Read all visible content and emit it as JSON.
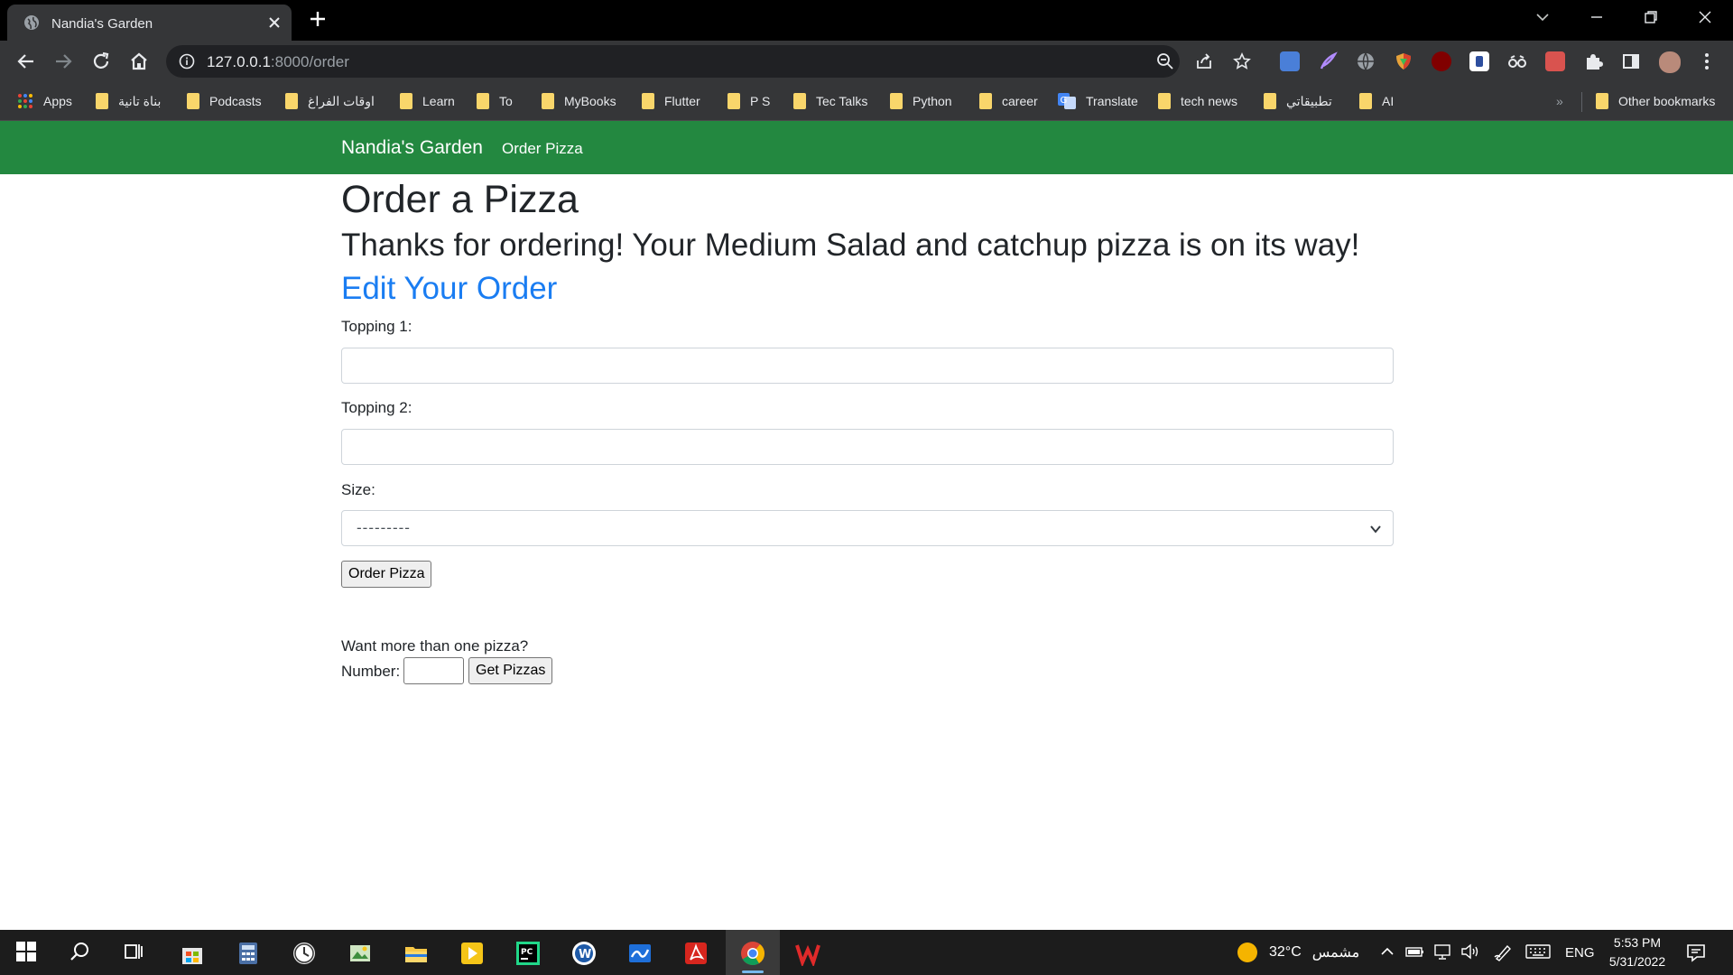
{
  "browser": {
    "tab_title": "Nandia's Garden",
    "url_host": "127.0.0.1",
    "url_rest": ":8000/order",
    "bookmarks": [
      {
        "label": "Apps",
        "type": "apps"
      },
      {
        "label": "بناة تانية",
        "type": "folder"
      },
      {
        "label": "Podcasts",
        "type": "folder"
      },
      {
        "label": "اوقات الفراغ",
        "type": "folder"
      },
      {
        "label": "Learn",
        "type": "folder"
      },
      {
        "label": "To",
        "type": "folder"
      },
      {
        "label": "MyBooks",
        "type": "folder"
      },
      {
        "label": "Flutter",
        "type": "folder"
      },
      {
        "label": "P S",
        "type": "folder"
      },
      {
        "label": "Tec Talks",
        "type": "folder"
      },
      {
        "label": "Python",
        "type": "folder"
      },
      {
        "label": "career",
        "type": "folder"
      },
      {
        "label": "Translate",
        "type": "translate"
      },
      {
        "label": "tech news",
        "type": "folder"
      },
      {
        "label": "تطبيقاتي",
        "type": "folder"
      },
      {
        "label": "AI",
        "type": "folder"
      }
    ],
    "other_bookmarks": "Other bookmarks",
    "overflow": "»"
  },
  "site": {
    "brand": "Nandia's Garden",
    "nav_link": "Order Pizza"
  },
  "page": {
    "heading": "Order a Pizza",
    "confirmation": "Thanks for ordering! Your Medium Salad and catchup pizza is on its way!",
    "edit_link": "Edit Your Order",
    "topping1_label": "Topping 1:",
    "topping1_value": "",
    "topping2_label": "Topping 2:",
    "topping2_value": "",
    "size_label": "Size:",
    "size_value": "---------",
    "submit_label": "Order Pizza",
    "more_text": "Want more than one pizza?",
    "number_label": "Number:",
    "number_value": "",
    "get_pizzas_label": "Get Pizzas"
  },
  "taskbar": {
    "weather": "32°C",
    "weather_desc": "مشمس",
    "language": "ENG",
    "time": "5:53 PM",
    "date": "5/31/2022"
  },
  "colors": {
    "navbar": "#238840",
    "link": "#1a7df2"
  }
}
